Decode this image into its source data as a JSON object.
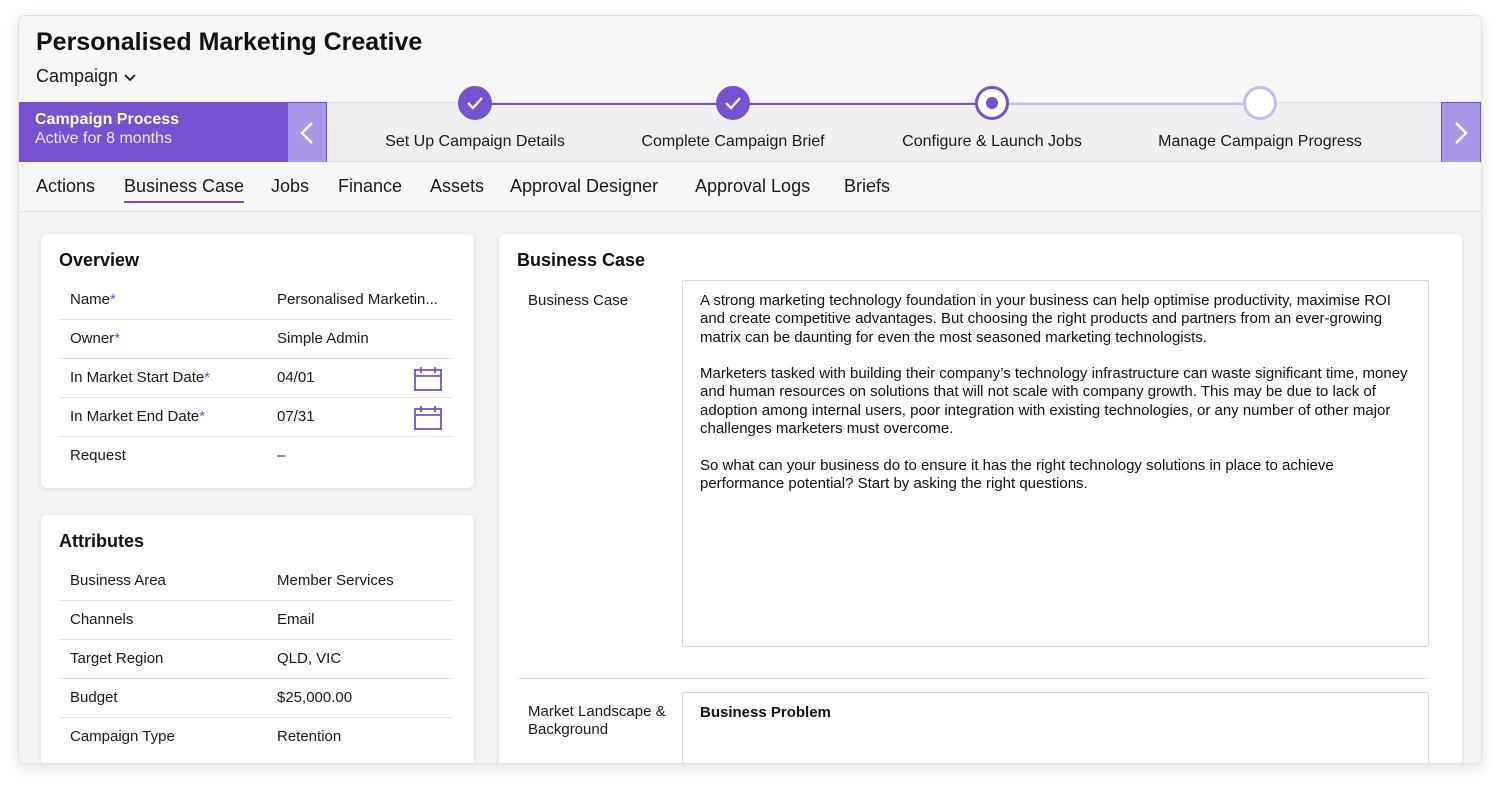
{
  "header": {
    "title": "Personalised Marketing Creative",
    "record_type": "Campaign"
  },
  "process": {
    "title": "Campaign Process",
    "subtitle": "Active for 8 months",
    "steps": [
      {
        "label": "Set Up Campaign Details",
        "state": "done"
      },
      {
        "label": "Complete Campaign Brief",
        "state": "done"
      },
      {
        "label": "Configure & Launch Jobs",
        "state": "current"
      },
      {
        "label": "Manage Campaign Progress",
        "state": "todo"
      }
    ]
  },
  "tabs": [
    "Actions",
    "Business Case",
    "Jobs",
    "Finance",
    "Assets",
    "Approval Designer",
    "Approval Logs",
    "Briefs"
  ],
  "active_tab": "Business Case",
  "overview": {
    "title": "Overview",
    "rows": [
      {
        "label": "Name",
        "required": "*",
        "value": "Personalised Marketin..."
      },
      {
        "label": "Owner",
        "required": "*",
        "value": "Simple Admin"
      },
      {
        "label": "In Market Start Date",
        "required": "*",
        "value": "04/01"
      },
      {
        "label": "In Market End Date",
        "required": "*",
        "value": "07/31"
      },
      {
        "label": "Request",
        "required": "",
        "value": "–"
      }
    ]
  },
  "attributes": {
    "title": "Attributes",
    "rows": [
      {
        "label": "Business Area",
        "value": "Member Services"
      },
      {
        "label": "Channels",
        "value": "Email"
      },
      {
        "label": "Target Region",
        "value": "QLD, VIC"
      },
      {
        "label": "Budget",
        "value": "$25,000.00"
      },
      {
        "label": "Campaign Type",
        "value": "Retention"
      }
    ]
  },
  "business_case": {
    "title": "Business Case",
    "field_label": "Business Case",
    "paragraphs": [
      "A strong marketing technology foundation in your business can help optimise productivity, maximise ROI and create competitive advantages. But choosing the right products and partners from an ever-growing matrix can be daunting for even the most seasoned marketing technologists.",
      "Marketers tasked with building their company’s technology infrastructure can waste significant time, money and human resources on solutions that will not scale with company growth. This may be due to lack of adoption among internal users, poor integration with existing technologies, or any number of other major challenges marketers must overcome.",
      "So what can your business do to ensure it has the right technology solutions in place to achieve performance potential? Start by asking the right questions."
    ],
    "market_label": "Market Landscape & Background",
    "market_heading": "Business Problem"
  },
  "colors": {
    "accent": "#7452d1",
    "accent_light": "#a996e8",
    "todo": "#c8bcef"
  }
}
